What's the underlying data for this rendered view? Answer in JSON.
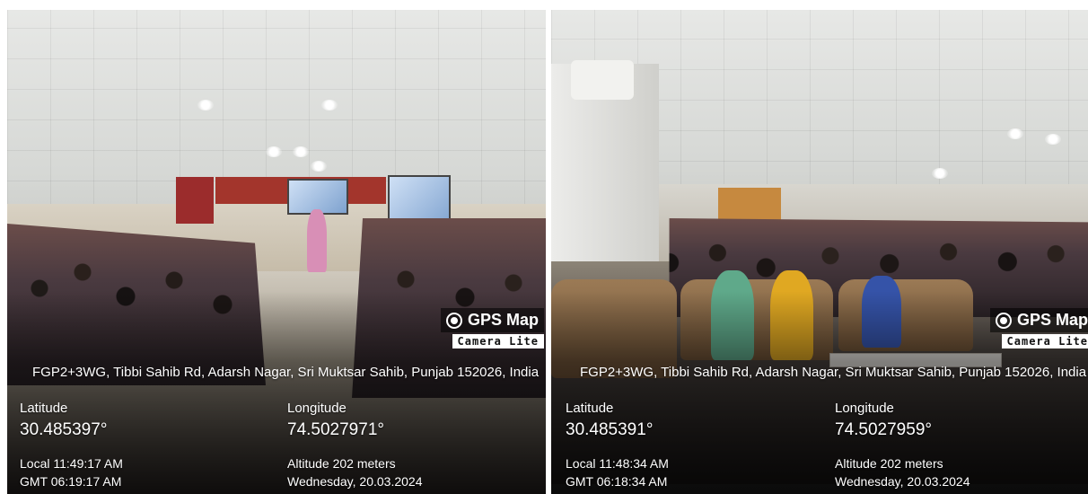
{
  "photos": [
    {
      "watermark": {
        "title": "GPS Map",
        "subtitle": "Camera Lite"
      },
      "address": "FGP2+3WG, Tibbi Sahib Rd, Adarsh Nagar, Sri Muktsar Sahib, Punjab 152026, India",
      "latitude_label": "Latitude",
      "latitude": "30.485397°",
      "longitude_label": "Longitude",
      "longitude": "74.5027971°",
      "local_time": "Local 11:49:17 AM",
      "gmt_time": "GMT 06:19:17 AM",
      "altitude": "Altitude 202 meters",
      "date": "Wednesday, 20.03.2024"
    },
    {
      "watermark": {
        "title": "GPS Map",
        "subtitle": "Camera Lite"
      },
      "address": "FGP2+3WG, Tibbi Sahib Rd, Adarsh Nagar, Sri Muktsar Sahib, Punjab 152026, India",
      "latitude_label": "Latitude",
      "latitude": "30.485391°",
      "longitude_label": "Longitude",
      "longitude": "74.5027959°",
      "local_time": "Local 11:48:34 AM",
      "gmt_time": "GMT 06:18:34 AM",
      "altitude": "Altitude 202 meters",
      "date": "Wednesday, 20.03.2024"
    }
  ]
}
